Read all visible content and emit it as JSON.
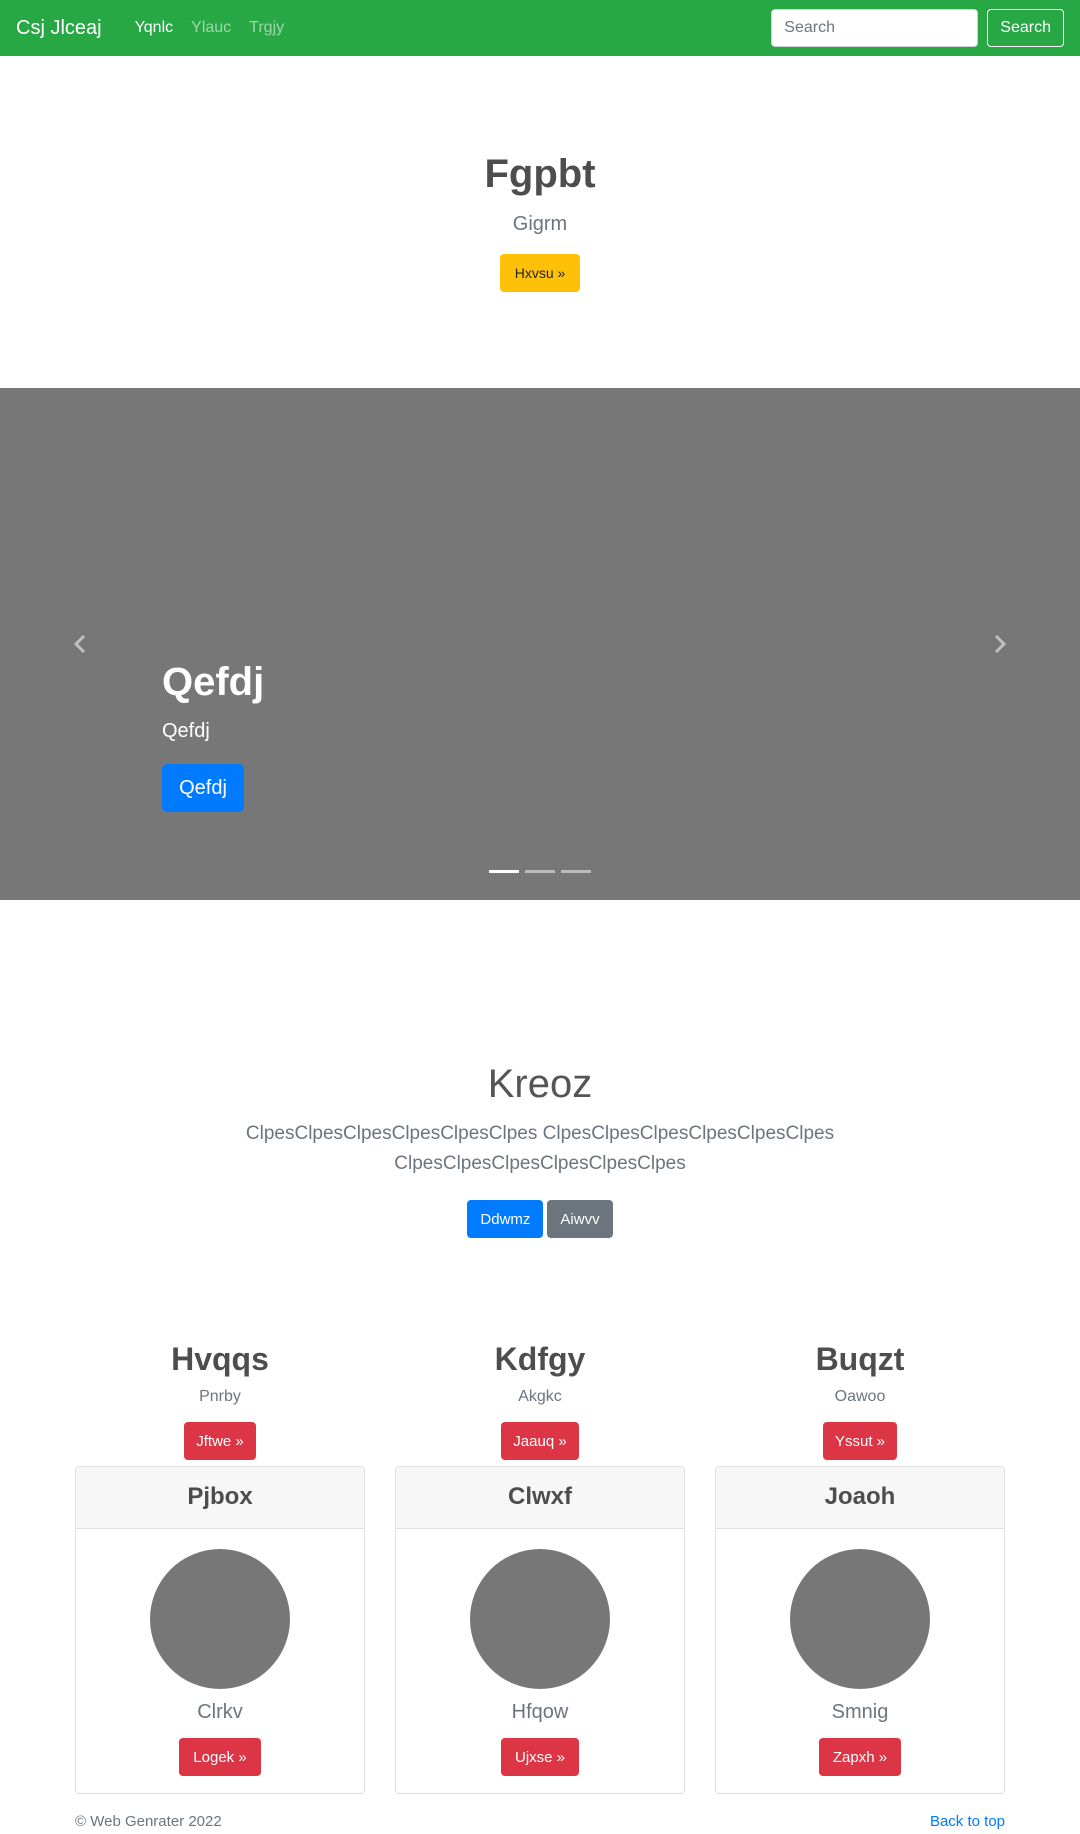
{
  "navbar": {
    "brand": "Csj Jlceaj",
    "links": [
      {
        "label": "Yqnlc",
        "active": true
      },
      {
        "label": "Ylauc",
        "active": false
      },
      {
        "label": "Trgjy",
        "active": false
      }
    ],
    "search_placeholder": "Search",
    "search_button": "Search",
    "color": "#28a745"
  },
  "hero": {
    "title": "Fgpbt",
    "subtitle": "Gigrm",
    "button": "Hxvsu »",
    "button_color": "#ffc107"
  },
  "carousel": {
    "background": "#777777",
    "prev_icon": "chevron-left-icon",
    "next_icon": "chevron-right-icon",
    "caption_title": "Qefdj",
    "caption_text": "Qefdj",
    "caption_button": "Qefdj",
    "indicators": 3,
    "active_indicator": 0
  },
  "intro": {
    "title": "Kreoz",
    "lead": "ClpesClpesClpesClpesClpesClpes ClpesClpesClpesClpesClpesClpes ClpesClpesClpesClpesClpesClpes",
    "primary_button": "Ddwmz",
    "secondary_button": "Aiwvv"
  },
  "features": [
    {
      "title": "Hvqqs",
      "subtitle": "Pnrby",
      "button": "Jftwe »"
    },
    {
      "title": "Kdfgy",
      "subtitle": "Akgkc",
      "button": "Jaauq »"
    },
    {
      "title": "Buqzt",
      "subtitle": "Oawoo",
      "button": "Yssut »"
    }
  ],
  "cards": [
    {
      "header": "Pjbox",
      "text": "Clrkv",
      "button": "Logek »"
    },
    {
      "header": "Clwxf",
      "text": "Hfqow",
      "button": "Ujxse »"
    },
    {
      "header": "Joaoh",
      "text": "Smnig",
      "button": "Zapxh »"
    }
  ],
  "footer": {
    "copyright": "© Web Genrater 2022",
    "back_to_top": "Back to top"
  }
}
